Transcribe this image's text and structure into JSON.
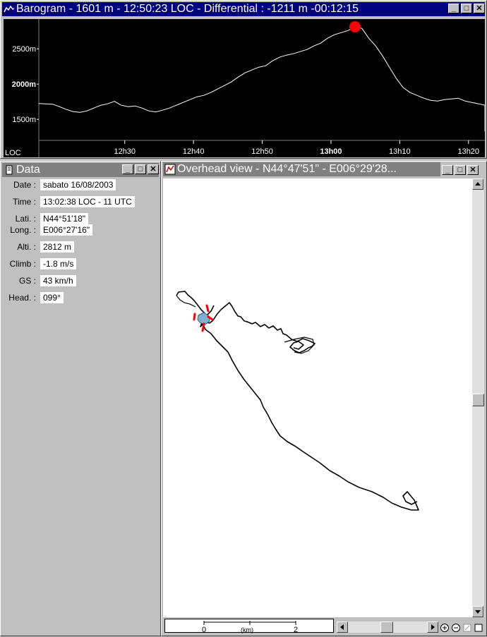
{
  "barogram": {
    "title": "Barogram  -  1601 m  - 12:50:23 LOC - Differential : -1211 m   -00:12:15",
    "y_ticks": [
      "2500m",
      "2000m",
      "1500m"
    ],
    "x_label": "LOC",
    "x_ticks": [
      "12h30",
      "12h40",
      "12h50",
      "13h00",
      "13h10",
      "13h20"
    ],
    "bold_tick": "13h00",
    "line_color": "#ffffff",
    "marker_color": "#ff0000"
  },
  "chart_data": {
    "type": "line",
    "title": "",
    "xlabel": "LOC",
    "ylabel": "",
    "x_unit": "minutes after 12h00",
    "ylim": [
      1300,
      2850
    ],
    "xlim": [
      17.5,
      28.2
    ],
    "x": [
      17.5,
      18.5,
      19.5,
      20.5,
      21.5,
      22.5,
      23.5,
      24.5,
      25.5,
      26.5,
      27.5,
      28.5,
      29.5,
      30.5,
      31.5,
      32.5,
      33.5,
      34.5,
      35.5,
      36.5,
      37.5,
      38.5,
      39.5,
      40.5,
      41.5,
      42.5,
      43.5,
      44.5,
      45.5,
      46.5,
      47.5,
      48.5,
      49.5,
      50.5,
      51.5,
      52.5,
      53.5,
      54.5,
      55.5,
      56.5,
      57.5,
      58.5,
      59.5,
      60.5,
      61.5,
      62.5,
      63.5,
      64.5,
      65.5,
      66.5,
      67.5,
      68.5,
      69.5,
      70.5,
      71.5,
      72.5,
      73.5,
      74.5,
      75.5,
      76.5,
      77.5,
      78.5,
      79.5,
      80.5,
      81.5,
      82.5,
      83.5,
      84.5,
      85.5,
      86.5
    ],
    "series": [
      {
        "values": [
          1725,
          1720,
          1715,
          1680,
          1640,
          1610,
          1600,
          1620,
          1660,
          1700,
          1720,
          1755,
          1700,
          1680,
          1690,
          1660,
          1620,
          1605,
          1630,
          1660,
          1700,
          1740,
          1780,
          1820,
          1840,
          1880,
          1930,
          1980,
          2030,
          2100,
          2160,
          2200,
          2240,
          2260,
          2330,
          2380,
          2410,
          2430,
          2460,
          2490,
          2540,
          2580,
          2650,
          2700,
          2730,
          2760,
          2812,
          2790,
          2650,
          2540,
          2400,
          2240,
          2080,
          1950,
          1880,
          1840,
          1800,
          1770,
          1760,
          1780,
          1790,
          1800,
          1760,
          1740,
          1720,
          1700,
          1680,
          1580,
          1450,
          1330
        ]
      }
    ]
  },
  "data": {
    "title": "Data",
    "rows": [
      {
        "label": "Date :",
        "value": "sabato 16/08/2003"
      },
      {
        "label": "Time :",
        "value": "13:02:38 LOC  -  11 UTC"
      },
      {
        "label": "Lati. :",
        "value": "N44°51'18\""
      },
      {
        "label": "Long. :",
        "value": "E006°27'16\""
      },
      {
        "label": "Alti. :",
        "value": "2812 m"
      },
      {
        "label": "Climb :",
        "value": "-1.8 m/s"
      },
      {
        "label": "GS :",
        "value": "43 km/h"
      },
      {
        "label": "Head. :",
        "value": "099°"
      }
    ]
  },
  "overhead": {
    "title": "Overhead view  -  N44°47'51\" - E006°29'28...",
    "scale_start": "0",
    "scale_unit": "(km)",
    "scale_end": "2",
    "track_color": "#000000",
    "highlight_color": "#ff0000",
    "water_color": "#7fb0d0"
  },
  "window_buttons": {
    "minimize": "_",
    "maximize": "□",
    "close": "✕"
  }
}
